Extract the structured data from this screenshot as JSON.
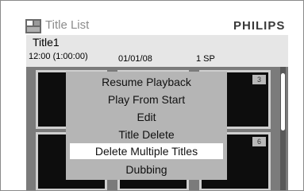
{
  "header": {
    "title": "Title List",
    "brand": "PHILIPS"
  },
  "title_info": {
    "name": "Title1",
    "time": "12:00 (1:00:00)",
    "date": "01/01/08",
    "mode": "1 SP"
  },
  "thumbnails": {
    "page_numbers": [
      "3",
      "6"
    ]
  },
  "menu": {
    "items": [
      {
        "label": "Resume Playback",
        "selected": false
      },
      {
        "label": "Play From Start",
        "selected": false
      },
      {
        "label": "Edit",
        "selected": false
      },
      {
        "label": "Title Delete",
        "selected": false
      },
      {
        "label": "Delete Multiple Titles",
        "selected": true
      },
      {
        "label": "Dubbing",
        "selected": false
      }
    ]
  },
  "colors": {
    "background": "#ffffff",
    "content_bg": "#7b7b7b",
    "menu_bg": "#b5b5b5",
    "selection": "#ffffff"
  }
}
